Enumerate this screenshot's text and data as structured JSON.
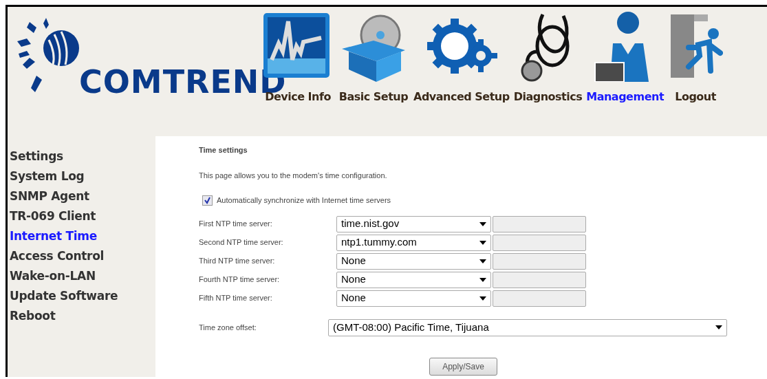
{
  "logo": {
    "text": "COMTREND"
  },
  "nav": [
    {
      "label": "Device Info",
      "kind": "chart",
      "selected": false
    },
    {
      "label": "Basic Setup",
      "kind": "box",
      "selected": false
    },
    {
      "label": "Advanced Setup",
      "kind": "gears",
      "selected": false
    },
    {
      "label": "Diagnostics",
      "kind": "stethoscope",
      "selected": false
    },
    {
      "label": "Management",
      "kind": "person",
      "selected": true
    },
    {
      "label": "Logout",
      "kind": "exit",
      "selected": false
    }
  ],
  "sidebar": {
    "items": [
      {
        "label": "Settings",
        "selected": false
      },
      {
        "label": "System Log",
        "selected": false
      },
      {
        "label": "SNMP Agent",
        "selected": false
      },
      {
        "label": "TR-069 Client",
        "selected": false
      },
      {
        "label": "Internet Time",
        "selected": true
      },
      {
        "label": "Access Control",
        "selected": false
      },
      {
        "label": "Wake-on-LAN",
        "selected": false
      },
      {
        "label": "Update Software",
        "selected": false
      },
      {
        "label": "Reboot",
        "selected": false
      }
    ]
  },
  "content": {
    "title": "Time settings",
    "description": "This page allows you to the modem's time configuration.",
    "auto_sync": {
      "label": "Automatically synchronize with Internet time servers",
      "checked": true
    },
    "servers": [
      {
        "label": "First NTP time server:",
        "value": "time.nist.gov"
      },
      {
        "label": "Second NTP time server:",
        "value": "ntp1.tummy.com"
      },
      {
        "label": "Third NTP time server:",
        "value": "None"
      },
      {
        "label": "Fourth NTP time server:",
        "value": "None"
      },
      {
        "label": "Fifth NTP time server:",
        "value": "None"
      }
    ],
    "timezone": {
      "label": "Time zone offset:",
      "value": "(GMT-08:00) Pacific Time, Tijuana"
    },
    "apply_button": "Apply/Save"
  }
}
